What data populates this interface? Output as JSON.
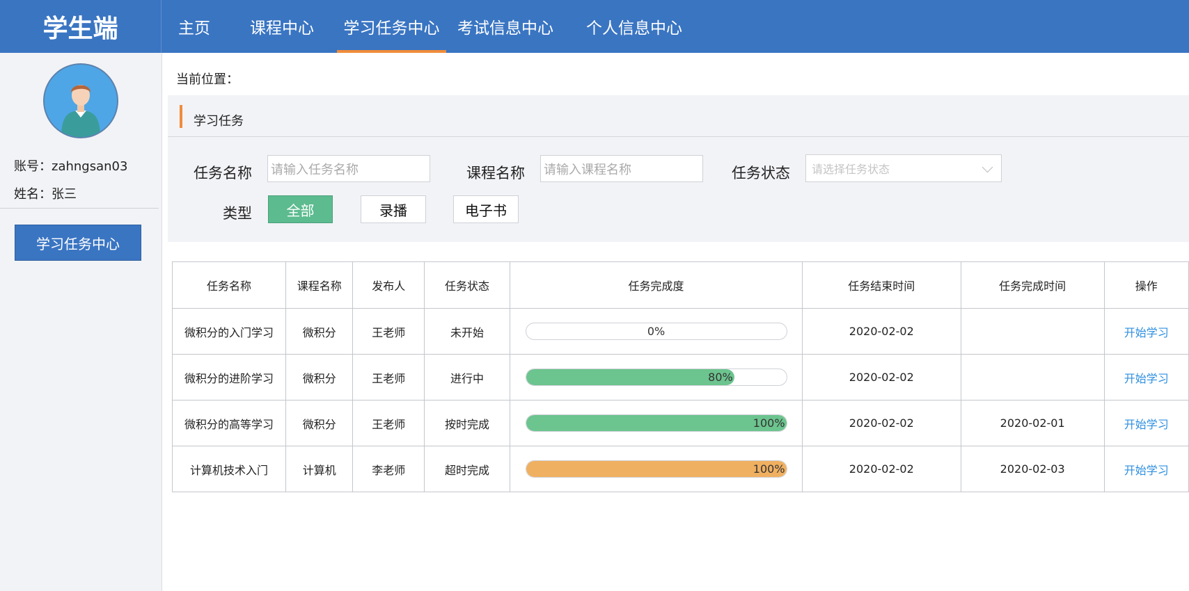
{
  "app": {
    "title": "学生端"
  },
  "nav": {
    "items": [
      {
        "label": "主页",
        "active": false
      },
      {
        "label": "课程中心",
        "active": false
      },
      {
        "label": "学习任务中心",
        "active": true
      },
      {
        "label": "考试信息中心",
        "active": false
      },
      {
        "label": "个人信息中心",
        "active": false
      }
    ]
  },
  "sidebar": {
    "account_label": "账号：",
    "account_value": "zahngsan03",
    "name_label": "姓名：",
    "name_value": "张三",
    "menu_button": "学习任务中心"
  },
  "breadcrumb": {
    "label": "当前位置："
  },
  "filter": {
    "section_title": "学习任务",
    "task_name_label": "任务名称",
    "task_name_placeholder": "请输入任务名称",
    "course_name_label": "课程名称",
    "course_name_placeholder": "请输入课程名称",
    "status_label": "任务状态",
    "status_placeholder": "请选择任务状态",
    "type_label": "类型",
    "types": [
      {
        "label": "全部",
        "active": true
      },
      {
        "label": "录播",
        "active": false
      },
      {
        "label": "电子书",
        "active": false
      }
    ]
  },
  "table": {
    "headers": [
      "任务名称",
      "课程名称",
      "发布人",
      "任务状态",
      "任务完成度",
      "任务结束时间",
      "任务完成时间",
      "操作"
    ],
    "rows": [
      {
        "task": "微积分的入门学习",
        "course": "微积分",
        "publisher": "王老师",
        "status": "未开始",
        "progress": 0,
        "progress_label": "0%",
        "progress_color": "#6cc48e",
        "end": "2020-02-02",
        "done": "",
        "action": "开始学习"
      },
      {
        "task": "微积分的进阶学习",
        "course": "微积分",
        "publisher": "王老师",
        "status": "进行中",
        "progress": 80,
        "progress_label": "80%",
        "progress_color": "#6cc48e",
        "end": "2020-02-02",
        "done": "",
        "action": "开始学习"
      },
      {
        "task": "微积分的高等学习",
        "course": "微积分",
        "publisher": "王老师",
        "status": "按时完成",
        "progress": 100,
        "progress_label": "100%",
        "progress_color": "#6cc48e",
        "end": "2020-02-02",
        "done": "2020-02-01",
        "action": "开始学习"
      },
      {
        "task": "计算机技术入门",
        "course": "计算机",
        "publisher": "李老师",
        "status": "超时完成",
        "progress": 100,
        "progress_label": "100%",
        "progress_color": "#f0b061",
        "end": "2020-02-02",
        "done": "2020-02-03",
        "action": "开始学习"
      }
    ]
  },
  "colors": {
    "primary": "#3a75c2",
    "accent": "#ef8c3a",
    "type_active": "#5cbb8f",
    "link": "#2d8fe0"
  }
}
